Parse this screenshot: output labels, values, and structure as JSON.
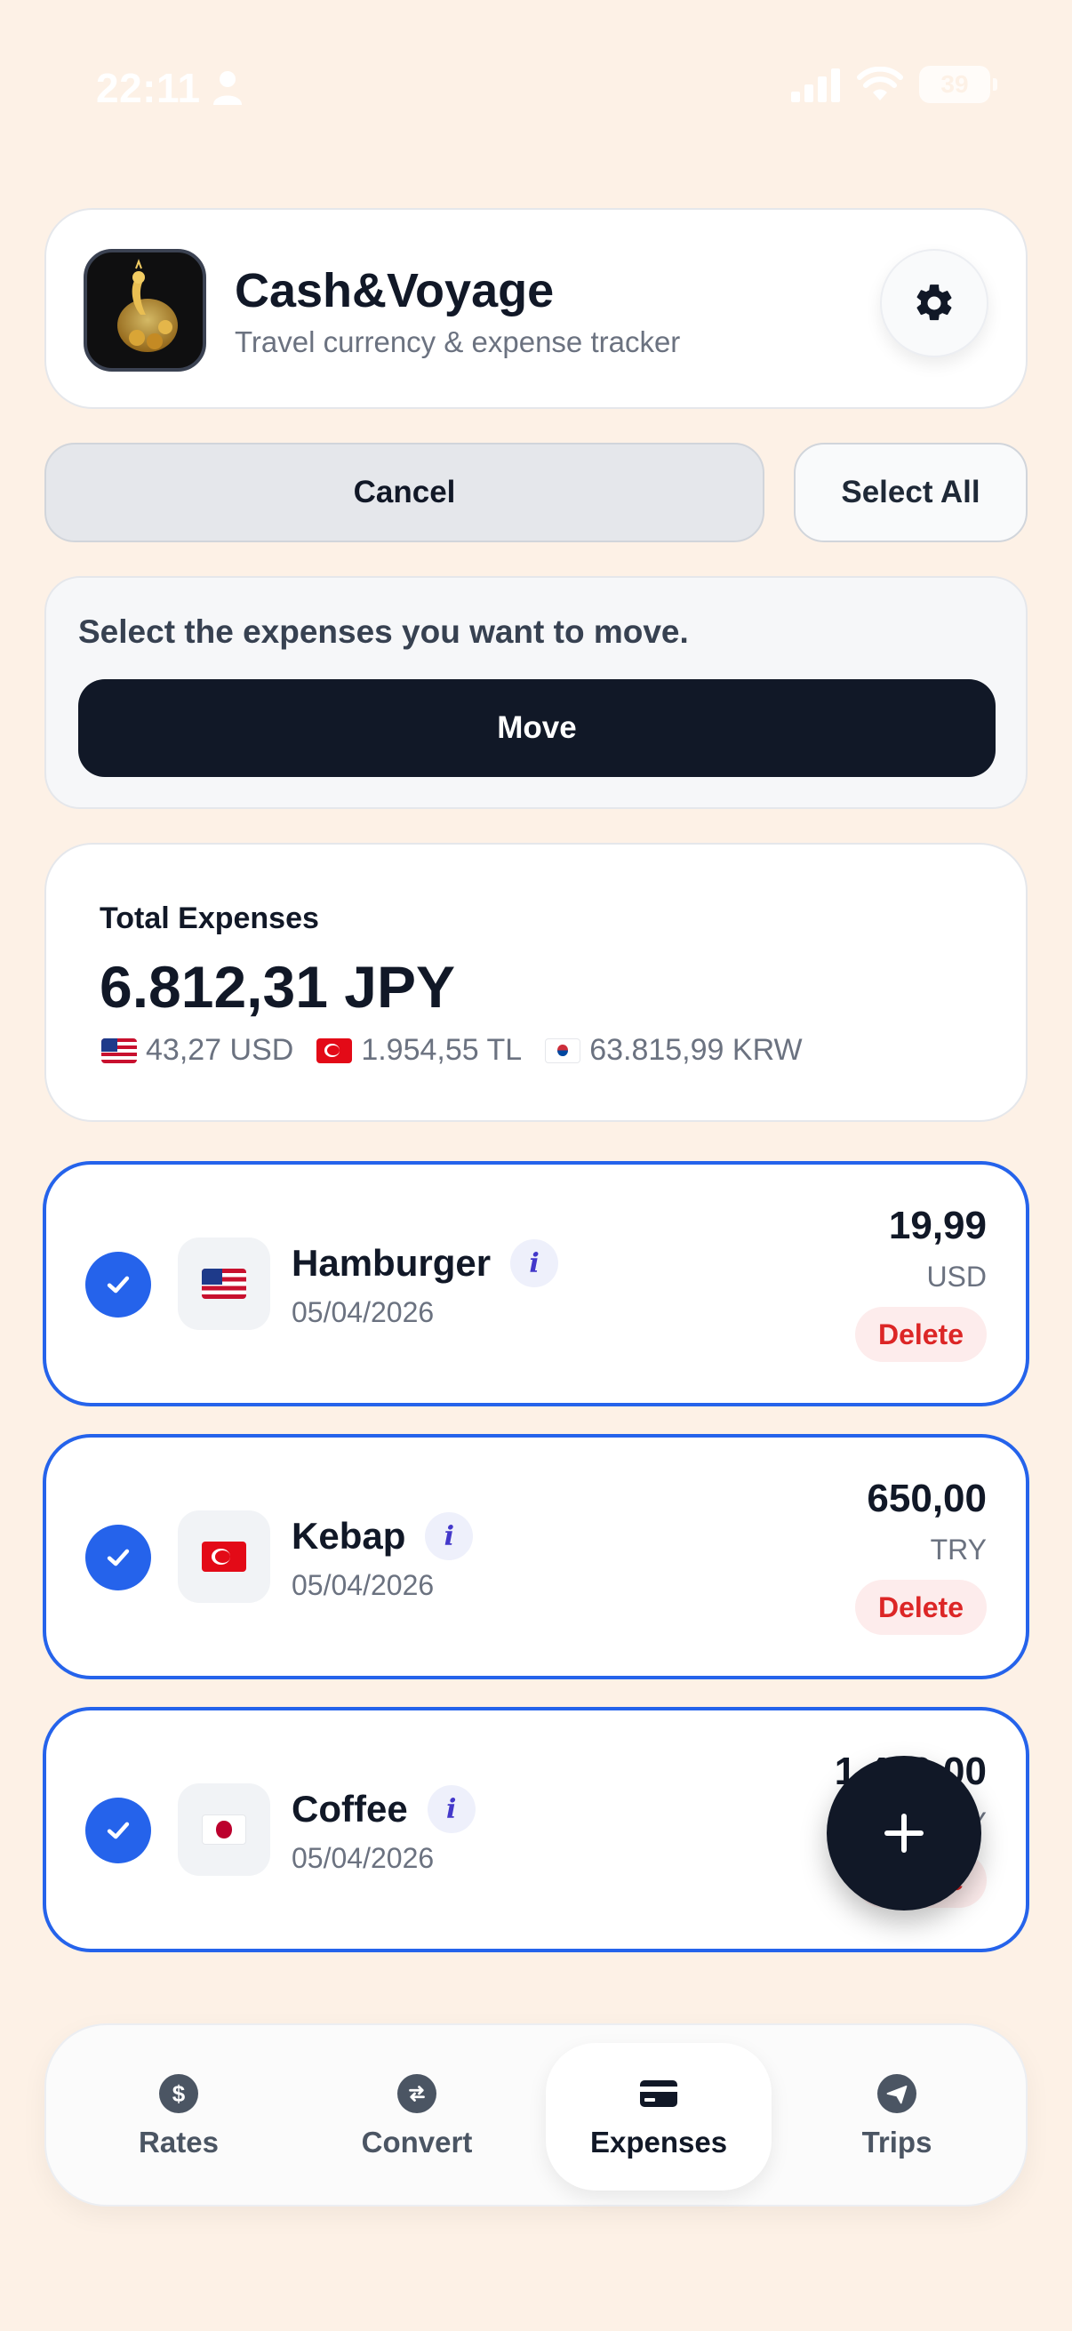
{
  "status_bar": {
    "time": "22:11",
    "battery": "39"
  },
  "header": {
    "title": "Cash&Voyage",
    "subtitle": "Travel currency & expense tracker"
  },
  "actions": {
    "cancel_label": "Cancel",
    "select_all_label": "Select All"
  },
  "move_panel": {
    "hint": "Select the expenses you want to move.",
    "move_label": "Move"
  },
  "total": {
    "label": "Total Expenses",
    "amount": "6.812,31 JPY",
    "conversions": [
      {
        "flag": "us",
        "value": "43,27 USD"
      },
      {
        "flag": "tr",
        "value": "1.954,55 TL"
      },
      {
        "flag": "kr",
        "value": "63.815,99 KRW"
      }
    ]
  },
  "expenses": [
    {
      "flag": "us",
      "name": "Hamburger",
      "date": "05/04/2026",
      "amount": "19,99",
      "currency": "USD",
      "delete_label": "Delete",
      "selected": true
    },
    {
      "flag": "tr",
      "name": "Kebap",
      "date": "05/04/2026",
      "amount": "650,00",
      "currency": "TRY",
      "delete_label": "Delete",
      "selected": true
    },
    {
      "flag": "jp",
      "name": "Coffee",
      "date": "05/04/2026",
      "amount": "1.400,00",
      "currency": "JPY",
      "delete_label": "Delete",
      "selected": true
    }
  ],
  "info_icon_label": "i",
  "nav": {
    "items": [
      {
        "label": "Rates",
        "icon": "dollar-icon"
      },
      {
        "label": "Convert",
        "icon": "convert-icon"
      },
      {
        "label": "Expenses",
        "icon": "card-icon",
        "active": true
      },
      {
        "label": "Trips",
        "icon": "plane-icon"
      }
    ]
  },
  "colors": {
    "accent": "#2563eb",
    "dark": "#111827",
    "background": "#fdf1e6",
    "danger": "#dc2626"
  }
}
